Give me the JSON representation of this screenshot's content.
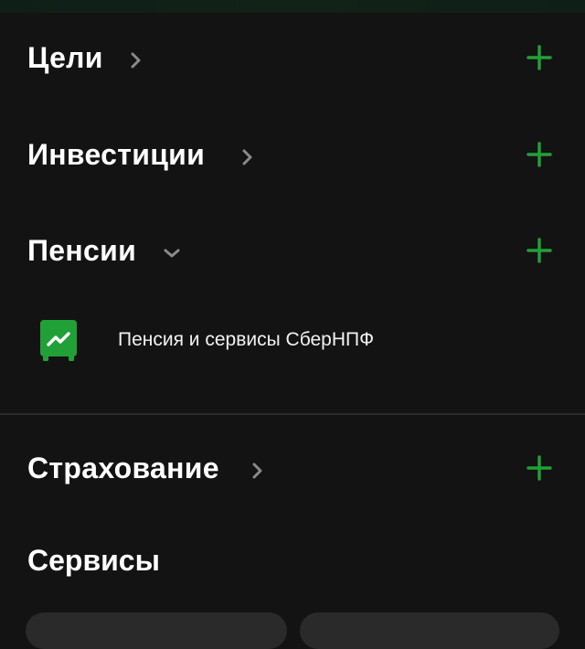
{
  "sections": {
    "goals": {
      "title": "Цели"
    },
    "investments": {
      "title": "Инвестиции"
    },
    "pensions": {
      "title": "Пенсии",
      "items": [
        {
          "label": "Пенсия и сервисы СберНПФ"
        }
      ]
    },
    "insurance": {
      "title": "Страхование"
    },
    "services": {
      "title": "Сервисы"
    }
  },
  "colors": {
    "background": "#131313",
    "accent": "#21a038",
    "chevron": "#8a8a8a",
    "divider": "#2a2a2a"
  },
  "icons": {
    "expand": "chevron-right-icon",
    "collapse": "chevron-down-icon",
    "add": "plus-icon",
    "pension_logo": "sber-npf-logo-icon"
  }
}
